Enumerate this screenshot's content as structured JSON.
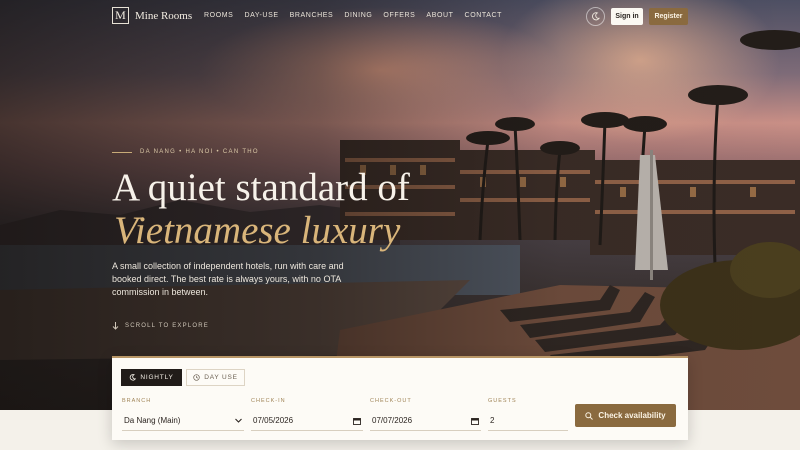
{
  "nav": {
    "brand_letter": "M",
    "brand_name": "Mine Rooms",
    "links": [
      "ROOMS",
      "DAY-USE",
      "BRANCHES",
      "DINING",
      "OFFERS",
      "ABOUT",
      "CONTACT"
    ],
    "theme_icon": "moon-icon",
    "signin_label": "Sign in",
    "register_label": "Register"
  },
  "hero": {
    "eyebrow": "DA NANG • HA NOI • CAN THO",
    "title_line1": "A quiet standard of",
    "title_line2": "Vietnamese luxury",
    "lede": "A small collection of independent hotels, run with care and booked direct. The best rate is always yours, with no OTA commission in between.",
    "scroll_label": "SCROLL TO EXPLORE"
  },
  "booking": {
    "tabs": [
      {
        "label": "NIGHTLY",
        "icon": "moon-icon",
        "active": true
      },
      {
        "label": "DAY USE",
        "icon": "clock-icon",
        "active": false
      }
    ],
    "branch_label": "BRANCH",
    "branch_value": "Da Nang (Main)",
    "checkin_label": "CHECK-IN",
    "checkin_value": "07/05/2026",
    "checkout_label": "CHECK-OUT",
    "checkout_value": "07/07/2026",
    "guests_label": "GUESTS",
    "guests_value": "2",
    "submit_label": "Check availability"
  },
  "colors": {
    "accent": "#8a6a3f",
    "accent_italic": "#d9b57a",
    "dark": "#211c19",
    "panel": "#fdfbf6"
  }
}
